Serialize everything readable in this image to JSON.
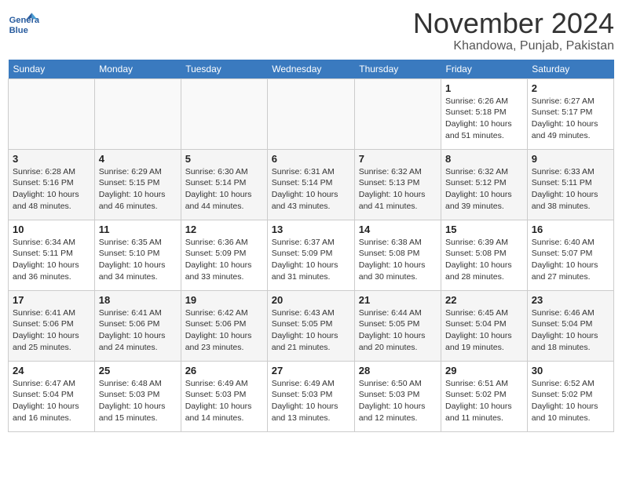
{
  "header": {
    "logo": {
      "line1": "General",
      "line2": "Blue"
    },
    "month": "November 2024",
    "location": "Khandowa, Punjab, Pakistan"
  },
  "weekdays": [
    "Sunday",
    "Monday",
    "Tuesday",
    "Wednesday",
    "Thursday",
    "Friday",
    "Saturday"
  ],
  "weeks": [
    [
      {
        "day": "",
        "info": ""
      },
      {
        "day": "",
        "info": ""
      },
      {
        "day": "",
        "info": ""
      },
      {
        "day": "",
        "info": ""
      },
      {
        "day": "",
        "info": ""
      },
      {
        "day": "1",
        "info": "Sunrise: 6:26 AM\nSunset: 5:18 PM\nDaylight: 10 hours and 51 minutes."
      },
      {
        "day": "2",
        "info": "Sunrise: 6:27 AM\nSunset: 5:17 PM\nDaylight: 10 hours and 49 minutes."
      }
    ],
    [
      {
        "day": "3",
        "info": "Sunrise: 6:28 AM\nSunset: 5:16 PM\nDaylight: 10 hours and 48 minutes."
      },
      {
        "day": "4",
        "info": "Sunrise: 6:29 AM\nSunset: 5:15 PM\nDaylight: 10 hours and 46 minutes."
      },
      {
        "day": "5",
        "info": "Sunrise: 6:30 AM\nSunset: 5:14 PM\nDaylight: 10 hours and 44 minutes."
      },
      {
        "day": "6",
        "info": "Sunrise: 6:31 AM\nSunset: 5:14 PM\nDaylight: 10 hours and 43 minutes."
      },
      {
        "day": "7",
        "info": "Sunrise: 6:32 AM\nSunset: 5:13 PM\nDaylight: 10 hours and 41 minutes."
      },
      {
        "day": "8",
        "info": "Sunrise: 6:32 AM\nSunset: 5:12 PM\nDaylight: 10 hours and 39 minutes."
      },
      {
        "day": "9",
        "info": "Sunrise: 6:33 AM\nSunset: 5:11 PM\nDaylight: 10 hours and 38 minutes."
      }
    ],
    [
      {
        "day": "10",
        "info": "Sunrise: 6:34 AM\nSunset: 5:11 PM\nDaylight: 10 hours and 36 minutes."
      },
      {
        "day": "11",
        "info": "Sunrise: 6:35 AM\nSunset: 5:10 PM\nDaylight: 10 hours and 34 minutes."
      },
      {
        "day": "12",
        "info": "Sunrise: 6:36 AM\nSunset: 5:09 PM\nDaylight: 10 hours and 33 minutes."
      },
      {
        "day": "13",
        "info": "Sunrise: 6:37 AM\nSunset: 5:09 PM\nDaylight: 10 hours and 31 minutes."
      },
      {
        "day": "14",
        "info": "Sunrise: 6:38 AM\nSunset: 5:08 PM\nDaylight: 10 hours and 30 minutes."
      },
      {
        "day": "15",
        "info": "Sunrise: 6:39 AM\nSunset: 5:08 PM\nDaylight: 10 hours and 28 minutes."
      },
      {
        "day": "16",
        "info": "Sunrise: 6:40 AM\nSunset: 5:07 PM\nDaylight: 10 hours and 27 minutes."
      }
    ],
    [
      {
        "day": "17",
        "info": "Sunrise: 6:41 AM\nSunset: 5:06 PM\nDaylight: 10 hours and 25 minutes."
      },
      {
        "day": "18",
        "info": "Sunrise: 6:41 AM\nSunset: 5:06 PM\nDaylight: 10 hours and 24 minutes."
      },
      {
        "day": "19",
        "info": "Sunrise: 6:42 AM\nSunset: 5:06 PM\nDaylight: 10 hours and 23 minutes."
      },
      {
        "day": "20",
        "info": "Sunrise: 6:43 AM\nSunset: 5:05 PM\nDaylight: 10 hours and 21 minutes."
      },
      {
        "day": "21",
        "info": "Sunrise: 6:44 AM\nSunset: 5:05 PM\nDaylight: 10 hours and 20 minutes."
      },
      {
        "day": "22",
        "info": "Sunrise: 6:45 AM\nSunset: 5:04 PM\nDaylight: 10 hours and 19 minutes."
      },
      {
        "day": "23",
        "info": "Sunrise: 6:46 AM\nSunset: 5:04 PM\nDaylight: 10 hours and 18 minutes."
      }
    ],
    [
      {
        "day": "24",
        "info": "Sunrise: 6:47 AM\nSunset: 5:04 PM\nDaylight: 10 hours and 16 minutes."
      },
      {
        "day": "25",
        "info": "Sunrise: 6:48 AM\nSunset: 5:03 PM\nDaylight: 10 hours and 15 minutes."
      },
      {
        "day": "26",
        "info": "Sunrise: 6:49 AM\nSunset: 5:03 PM\nDaylight: 10 hours and 14 minutes."
      },
      {
        "day": "27",
        "info": "Sunrise: 6:49 AM\nSunset: 5:03 PM\nDaylight: 10 hours and 13 minutes."
      },
      {
        "day": "28",
        "info": "Sunrise: 6:50 AM\nSunset: 5:03 PM\nDaylight: 10 hours and 12 minutes."
      },
      {
        "day": "29",
        "info": "Sunrise: 6:51 AM\nSunset: 5:02 PM\nDaylight: 10 hours and 11 minutes."
      },
      {
        "day": "30",
        "info": "Sunrise: 6:52 AM\nSunset: 5:02 PM\nDaylight: 10 hours and 10 minutes."
      }
    ]
  ]
}
